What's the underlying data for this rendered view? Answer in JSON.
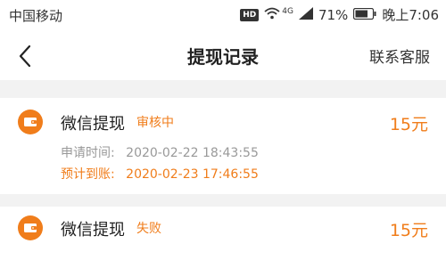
{
  "status_bar": {
    "carrier": "中国移动",
    "hd": "HD",
    "network": "4G",
    "battery": "71%",
    "time": "晚上7:06"
  },
  "nav": {
    "title": "提现记录",
    "action": "联系客服"
  },
  "records": [
    {
      "type": "微信提现",
      "status": "审核中",
      "amount": "15元",
      "apply_label": "申请时间:",
      "apply_time": "2020-02-22 18:43:55",
      "arrive_label": "预计到账:",
      "arrive_time": "2020-02-23 17:46:55"
    },
    {
      "type": "微信提现",
      "status": "失败",
      "amount": "15元"
    }
  ],
  "colors": {
    "accent": "#f07d1b",
    "background": "#f2f2f2",
    "muted_text": "#999999"
  }
}
